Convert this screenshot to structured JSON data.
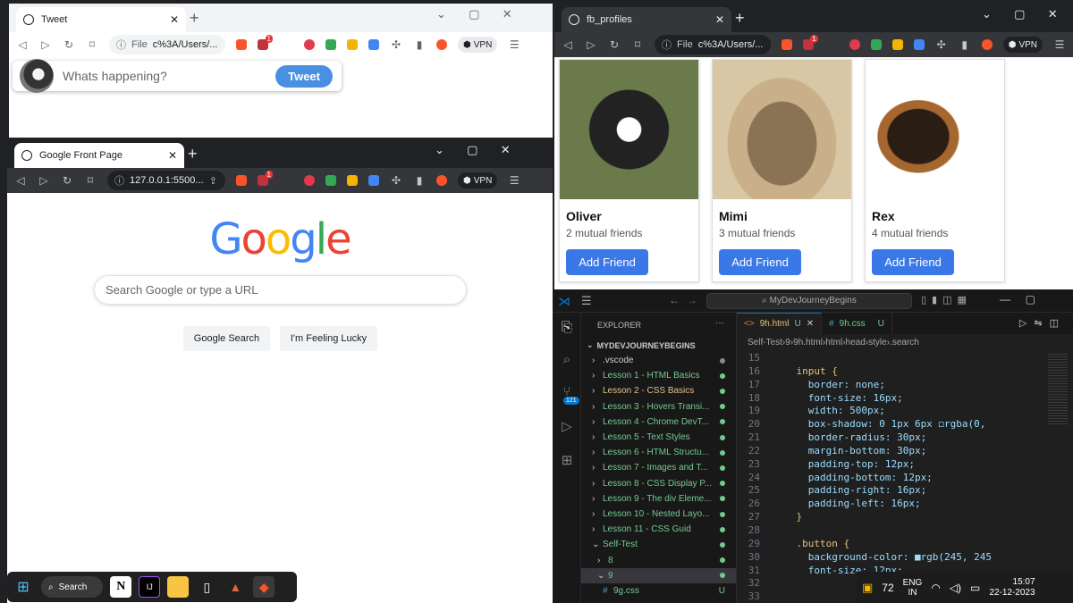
{
  "tweet_window": {
    "tab_title": "Tweet",
    "address_scheme": "File",
    "address": "c%3A/Users/...",
    "shield_count": "1",
    "vpn_label": "VPN",
    "placeholder": "Whats happening?",
    "tweet_button": "Tweet"
  },
  "google_window": {
    "tab_title": "Google Front Page",
    "address": "127.0.0.1:5500...",
    "shield_count": "1",
    "vpn_label": "VPN",
    "logo_letters": [
      "G",
      "o",
      "o",
      "g",
      "l",
      "e"
    ],
    "logo_colors": [
      "#4285F4",
      "#EA4335",
      "#FBBC05",
      "#4285F4",
      "#34A853",
      "#EA4335"
    ],
    "search_placeholder": "Search Google or type a URL",
    "search_button": "Google Search",
    "lucky_button": "I'm Feeling Lucky"
  },
  "fb_window": {
    "tab_title": "fb_profiles",
    "address_scheme": "File",
    "address": "c%3A/Users/...",
    "shield_count": "1",
    "vpn_label": "VPN",
    "cards": [
      {
        "name": "Oliver",
        "mutual": "2 mutual friends",
        "button": "Add Friend"
      },
      {
        "name": "Mimi",
        "mutual": "3 mutual friends",
        "button": "Add Friend"
      },
      {
        "name": "Rex",
        "mutual": "4 mutual friends",
        "button": "Add Friend"
      }
    ]
  },
  "vscode": {
    "command_center": "MyDevJourneyBegins",
    "explorer_title": "EXPLORER",
    "root_folder": "MYDEVJOURNEYBEGINS",
    "scm_badge": "121",
    "tree": [
      {
        "label": ".vscode",
        "depth": 1,
        "arrow": "›",
        "color": "#cccccc"
      },
      {
        "label": "Lesson 1 - HTML Basics",
        "depth": 1,
        "arrow": "›",
        "color": "#73c991"
      },
      {
        "label": "Lesson 2 - CSS Basics",
        "depth": 1,
        "arrow": "›",
        "color": "#e2c08d"
      },
      {
        "label": "Lesson 3 - Hovers Transi...",
        "depth": 1,
        "arrow": "›",
        "color": "#73c991"
      },
      {
        "label": "Lesson 4 - Chrome DevT...",
        "depth": 1,
        "arrow": "›",
        "color": "#73c991"
      },
      {
        "label": "Lesson 5 - Text Styles",
        "depth": 1,
        "arrow": "›",
        "color": "#73c991"
      },
      {
        "label": "Lesson 6 - HTML Structu...",
        "depth": 1,
        "arrow": "›",
        "color": "#73c991"
      },
      {
        "label": "Lesson 7 - Images and T...",
        "depth": 1,
        "arrow": "›",
        "color": "#73c991"
      },
      {
        "label": "Lesson 8 - CSS Display P...",
        "depth": 1,
        "arrow": "›",
        "color": "#73c991"
      },
      {
        "label": "Lesson 9 - The div Eleme...",
        "depth": 1,
        "arrow": "›",
        "color": "#73c991"
      },
      {
        "label": "Lesson 10 - Nested Layo...",
        "depth": 1,
        "arrow": "›",
        "color": "#73c991"
      },
      {
        "label": "Lesson 11 - CSS Guid",
        "depth": 1,
        "arrow": "›",
        "color": "#73c991"
      },
      {
        "label": "Self-Test",
        "depth": 1,
        "arrow": "⌄",
        "color": "#73c991"
      },
      {
        "label": "8",
        "depth": 2,
        "arrow": "›",
        "color": "#73c991"
      },
      {
        "label": "9",
        "depth": 2,
        "arrow": "⌄",
        "color": "#73c991"
      },
      {
        "label": "9g.css",
        "depth": 3,
        "arrow": "#",
        "color": "#73c991",
        "badge": "U"
      }
    ],
    "tabs": [
      {
        "label": "9h.html",
        "status": "U",
        "active": true
      },
      {
        "label": "9h.css",
        "status": "U",
        "active": false
      }
    ],
    "breadcrumb": [
      "Self-Test",
      "9",
      "9h.html",
      "html",
      "head",
      "style",
      ".search"
    ],
    "line_numbers": [
      "15",
      "16",
      "17",
      "18",
      "19",
      "20",
      "21",
      "22",
      "23",
      "24",
      "25",
      "26",
      "27",
      "28",
      "29",
      "30",
      "31",
      "32",
      "33"
    ],
    "code_lines": [
      "",
      "    input {",
      "      border: none;",
      "      font-size: 16px;",
      "      width: 500px;",
      "      box-shadow: 0 1px 6px ◻rgba(0,",
      "      border-radius: 30px;",
      "      margin-bottom: 30px;",
      "      padding-top: 12px;",
      "      padding-bottom: 12px;",
      "      padding-right: 16px;",
      "      padding-left: 16px;",
      "    }",
      "",
      "    .button {",
      "      background-color: ■rgb(245, 245",
      "      font-size: 12px;",
      "",
      ""
    ]
  },
  "taskbar": {
    "search_label": "Search"
  },
  "tray": {
    "temperature": "72",
    "lang_top": "ENG",
    "lang_bottom": "IN",
    "time": "15:07",
    "date": "22-12-2023"
  },
  "colors": {
    "tweet_blue": "#4a90e2",
    "fb_blue": "#3b78e7",
    "vscode_blue": "#0078d4"
  }
}
